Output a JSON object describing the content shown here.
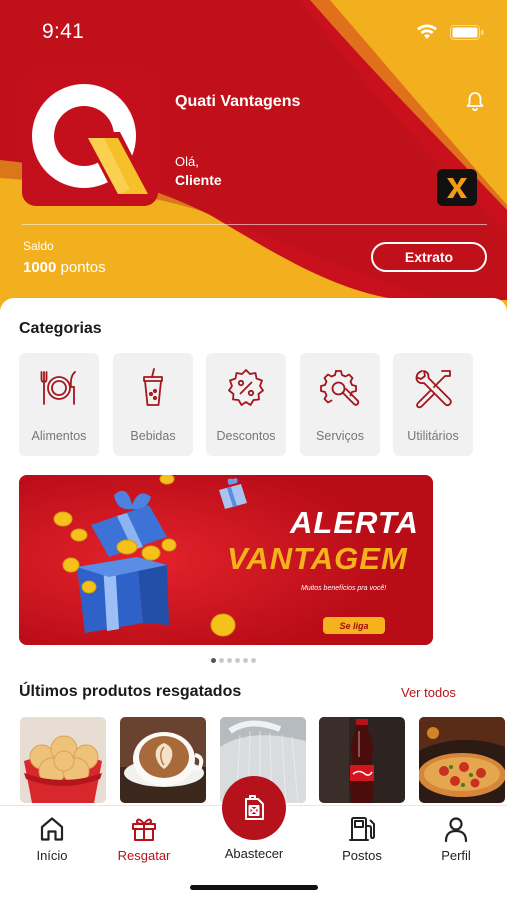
{
  "status_bar": {
    "time": "9:41"
  },
  "header": {
    "brand_name": "Quati Vantagens",
    "greeting": "Olá,",
    "user_name": "Cliente",
    "badge_letter": "X",
    "balance_label": "Saldo",
    "balance_value": "1000",
    "balance_unit": "pontos",
    "statement_button": "Extrato"
  },
  "categories": {
    "title": "Categorias",
    "items": [
      {
        "label": "Alimentos",
        "icon": "fork-plate-knife-icon"
      },
      {
        "label": "Bebidas",
        "icon": "drink-cup-icon"
      },
      {
        "label": "Descontos",
        "icon": "discount-badge-icon"
      },
      {
        "label": "Serviços",
        "icon": "gear-wrench-icon"
      },
      {
        "label": "Utilitários",
        "icon": "tools-icon"
      }
    ]
  },
  "banner": {
    "title_line1": "ALERTA",
    "title_line2": "VANTAGEM",
    "subtitle": "Muitos benefícios pra você!",
    "cta": "Se liga",
    "page_count": 6,
    "active_page": 1
  },
  "recent": {
    "title": "Últimos produtos resgatados",
    "see_all": "Ver todos",
    "items": [
      "cheese-bread",
      "cappuccino",
      "car-wash",
      "coca-cola-bottle",
      "pizza"
    ]
  },
  "tabbar": {
    "items": [
      {
        "label": "Início",
        "icon": "home-icon",
        "active": false
      },
      {
        "label": "Resgatar",
        "icon": "gift-icon",
        "active": true
      },
      {
        "label": "Abastecer",
        "icon": "fuel-can-icon",
        "active": false
      },
      {
        "label": "Postos",
        "icon": "gas-pump-icon",
        "active": false
      },
      {
        "label": "Perfil",
        "icon": "user-icon",
        "active": false
      }
    ]
  },
  "colors": {
    "brand_red": "#c4101c",
    "brand_yellow": "#f2b01e",
    "accent_text": "#b5121b"
  }
}
